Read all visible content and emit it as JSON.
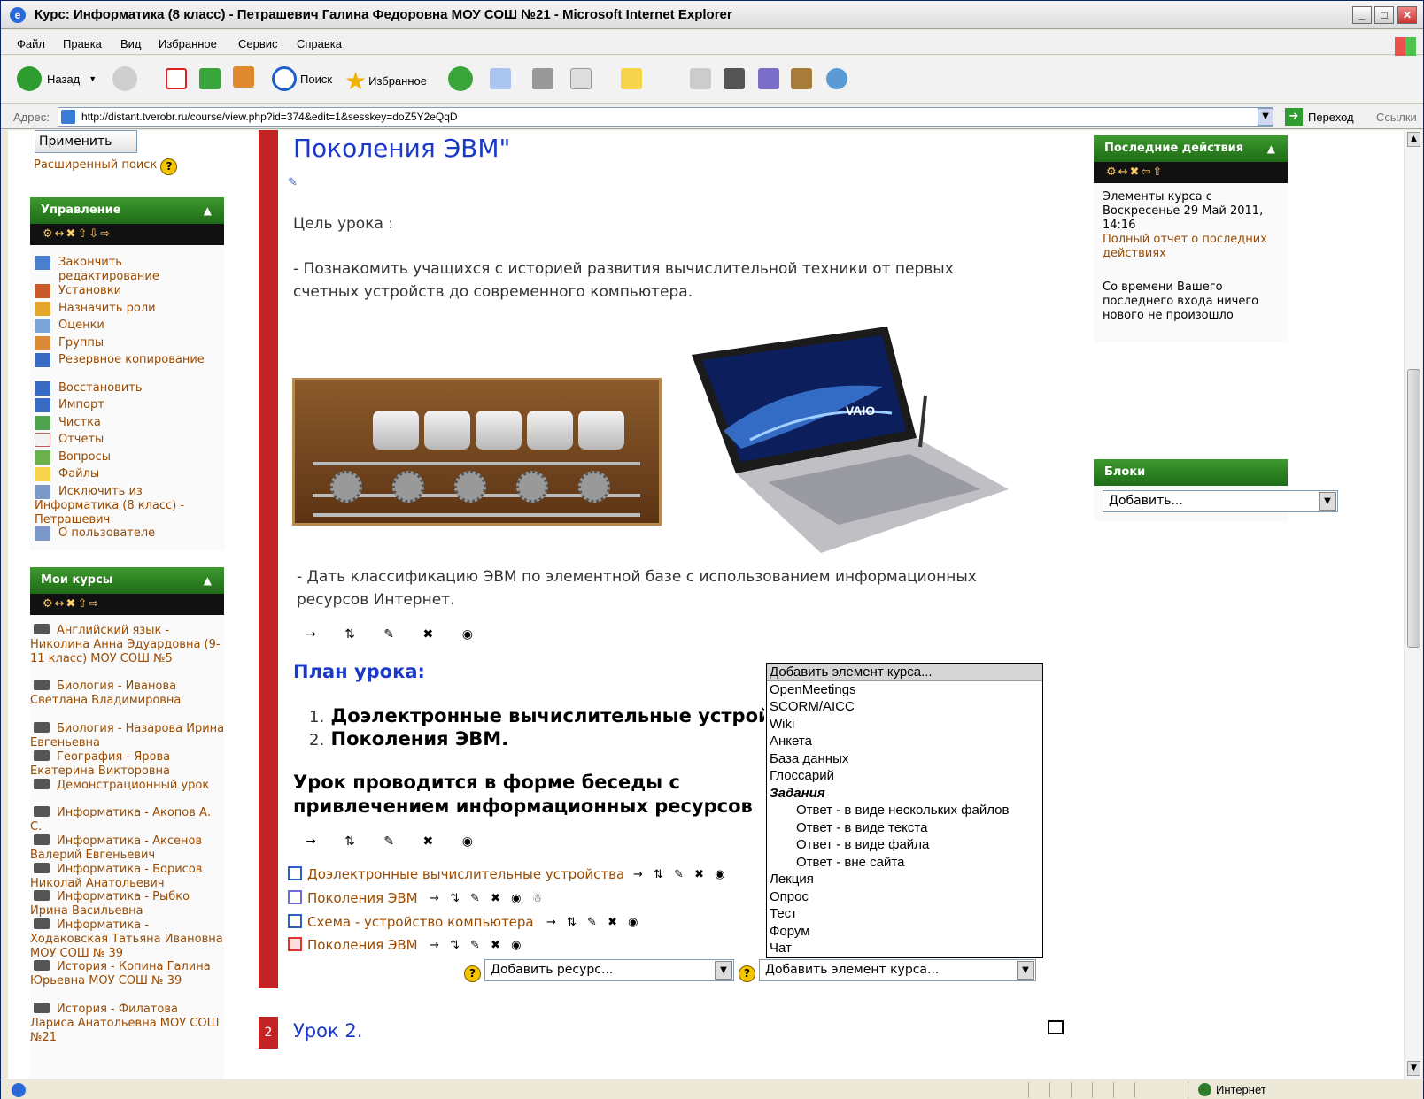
{
  "window": {
    "title": "Курс: Информатика (8 класс) - Петрашевич Галина Федоровна МОУ СОШ №21 - Microsoft Internet Explorer",
    "ie_badge": "e",
    "min": "_",
    "max": "□",
    "close": "✕"
  },
  "menu": [
    "Файл",
    "Правка",
    "Вид",
    "Избранное",
    "Сервис",
    "Справка"
  ],
  "toolbar": {
    "back": "Назад",
    "search": "Поиск",
    "favorites": "Избранное"
  },
  "address": {
    "label": "Адрес:",
    "url": "http://distant.tverobr.ru/course/view.php?id=374&edit=1&sesskey=doZ5Y2eQqD",
    "go": "Переход",
    "links": "Ссылки"
  },
  "left": {
    "apply_button": "Применить",
    "advanced_search": "Расширенный поиск",
    "admin_block": {
      "title": "Управление",
      "collapse": "▲",
      "tools": "⚙↔✖⇧⇩⇨",
      "items": [
        "Закончить редактирование",
        "Установки",
        "Назначить роли",
        "Оценки",
        "Группы",
        "Резервное копирование",
        "Восстановить",
        "Импорт",
        "Чистка",
        "Отчеты",
        "Вопросы",
        "Файлы",
        "Исключить из Информатика (8 класс) - Петрашевич",
        "О пользователе"
      ]
    },
    "courses_block": {
      "title": "Мои курсы",
      "collapse": "▲",
      "tools": "⚙↔✖⇧⇨",
      "items": [
        "Английский язык - Николина Анна Эдуардовна (9-11 класс) МОУ СОШ №5",
        "Биология - Иванова Светлана Владимировна",
        "Биология - Назарова Ирина Евгеньевна",
        "География - Ярова Екатерина Викторовна",
        "Демонстрационный урок",
        "Информатика - Акопов А. С.",
        "Информатика - Аксенов Валерий Евгеньевич",
        "Информатика - Борисов Николай Анатольевич",
        "Информатика - Рыбко Ирина Васильевна",
        "Информатика - Ходаковская Татьяна Ивановна МОУ СОШ № 39",
        "История - Копина Галина Юрьевна МОУ СОШ № 39",
        "История - Филатова Лариса Анатольевна МОУ СОШ №21"
      ]
    }
  },
  "main": {
    "heading": "Поколения ЭВМ\"",
    "goal_label": "Цель урока :",
    "goal_1": "- Познакомить учащихся с историей развития вычислительной техники от первых счетных устройств до современного компьютера.",
    "goal_2": "- Дать классификацию ЭВМ по элементной базе с использованием информационных ресурсов Интернет.",
    "laptop_brand": "VAIO",
    "controls": "→ ⇅ ✎ ✖ ◉",
    "plan_heading": "План урока:",
    "plan_items": [
      "Доэлектронные вычислительные устройства.",
      "Поколения ЭВМ."
    ],
    "plan_numbers": [
      "1.",
      "2."
    ],
    "lesson_form": "Урок проводится в форме беседы с привлечением информационных ресурсов Интернет.",
    "resources": [
      "Доэлектронные вычислительные устройства",
      "Поколения ЭВМ",
      "Схема - устройство компьютера",
      "Поколения ЭВМ"
    ],
    "resource_controls": [
      "→ ⇅ ✎ ✖ ◉",
      "→ ⇅ ✎ ✖ ◉ ☃",
      "→ ⇅ ✎ ✖ ◉",
      "→ ⇅ ✎ ✖ ◉"
    ],
    "add_resource": "Добавить ресурс...",
    "add_activity": "Добавить элемент курса...",
    "help": "?",
    "section_number": "2",
    "section_title": "Урок 2."
  },
  "dropdown_options": [
    {
      "label": "Добавить элемент курса...",
      "kind": "selected"
    },
    {
      "label": "OpenMeetings",
      "kind": "item"
    },
    {
      "label": "SCORM/AICC",
      "kind": "item"
    },
    {
      "label": "Wiki",
      "kind": "item"
    },
    {
      "label": "Анкета",
      "kind": "item"
    },
    {
      "label": "База данных",
      "kind": "item"
    },
    {
      "label": "Глоссарий",
      "kind": "item"
    },
    {
      "label": "Задания",
      "kind": "group"
    },
    {
      "label": "Ответ - в виде нескольких файлов",
      "kind": "sub"
    },
    {
      "label": "Ответ - в виде текста",
      "kind": "sub"
    },
    {
      "label": "Ответ - в виде файла",
      "kind": "sub"
    },
    {
      "label": "Ответ - вне сайта",
      "kind": "sub"
    },
    {
      "label": "Лекция",
      "kind": "item"
    },
    {
      "label": "Опрос",
      "kind": "item"
    },
    {
      "label": "Тест",
      "kind": "item"
    },
    {
      "label": "Форум",
      "kind": "item"
    },
    {
      "label": "Чат",
      "kind": "item"
    }
  ],
  "right": {
    "recent": {
      "title": "Последние действия",
      "collapse": "▲",
      "tools": "⚙↔✖⇦⇧",
      "since": "Элементы курса с Воскресенье 29 Май 2011, 14:16",
      "full_report": "Полный отчет о последних действиях",
      "nothing_new": "Со времени Вашего последнего входа ничего нового не произошло"
    },
    "blocks": {
      "title": "Блоки",
      "add": "Добавить..."
    }
  },
  "status": {
    "zone": "Интернет"
  },
  "colors": {
    "block_green": "#2e8a22",
    "red_bar": "#c42323",
    "link_brown": "#9a4b00",
    "heading_blue": "#1a39c8"
  }
}
